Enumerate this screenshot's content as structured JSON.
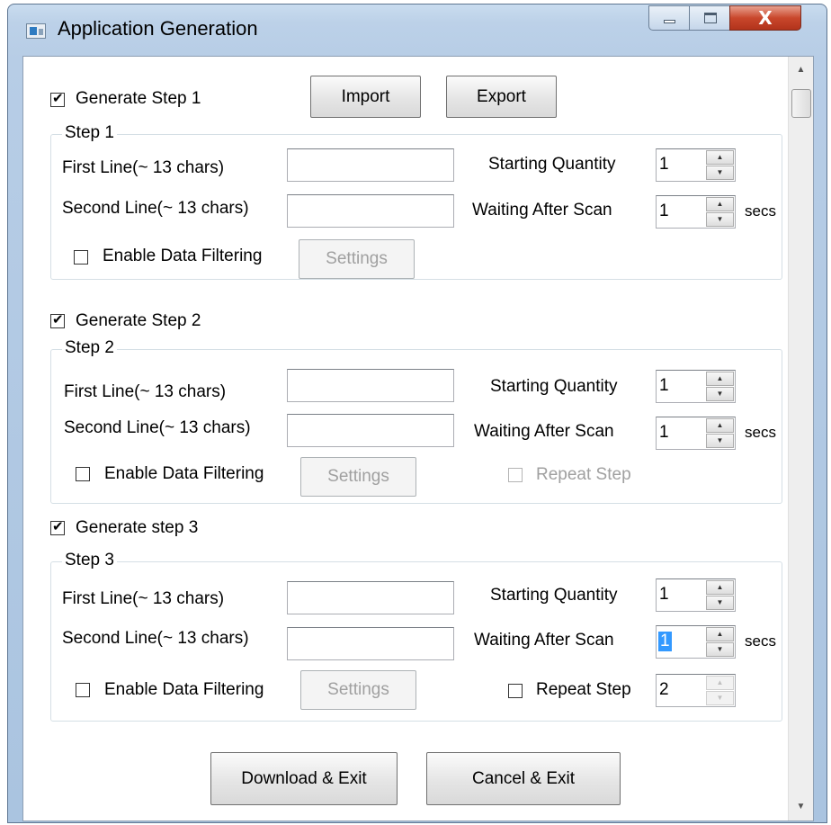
{
  "window": {
    "title": "Application Generation",
    "controls": {
      "close": "X"
    }
  },
  "top": {
    "generate_step1": {
      "label": "Generate Step 1",
      "checked": true
    },
    "import_label": "Import",
    "export_label": "Export"
  },
  "steps": [
    {
      "legend": "Step 1",
      "first_line_label": "First Line(~ 13 chars)",
      "first_line_value": "",
      "second_line_label": "Second Line(~ 13 chars)",
      "second_line_value": "",
      "starting_quantity_label": "Starting Quantity",
      "starting_quantity": "1",
      "waiting_label": "Waiting After Scan",
      "waiting_value": "1",
      "secs": "secs",
      "filtering_label": "Enable Data Filtering",
      "filtering_checked": false,
      "settings_label": "Settings"
    },
    {
      "generate_label": "Generate Step 2",
      "generate_checked": true,
      "legend": "Step 2",
      "first_line_label": "First Line(~ 13 chars)",
      "first_line_value": "",
      "second_line_label": "Second Line(~ 13 chars)",
      "second_line_value": "",
      "starting_quantity_label": "Starting Quantity",
      "starting_quantity": "1",
      "waiting_label": "Waiting After Scan",
      "waiting_value": "1",
      "secs": "secs",
      "filtering_label": "Enable Data Filtering",
      "filtering_checked": false,
      "settings_label": "Settings",
      "repeat_label": "Repeat Step",
      "repeat_enabled": false
    },
    {
      "generate_label": "Generate step 3",
      "generate_checked": true,
      "legend": "Step 3",
      "first_line_label": "First Line(~ 13 chars)",
      "first_line_value": "",
      "second_line_label": "Second Line(~ 13 chars)",
      "second_line_value": "",
      "starting_quantity_label": "Starting Quantity",
      "starting_quantity": "1",
      "waiting_label": "Waiting After Scan",
      "waiting_value": "1",
      "secs": "secs",
      "filtering_label": "Enable Data Filtering",
      "filtering_checked": false,
      "settings_label": "Settings",
      "repeat_label": "Repeat Step",
      "repeat_checked": false,
      "repeat_count": "2"
    }
  ],
  "footer": {
    "download_label": "Download & Exit",
    "cancel_label": "Cancel & Exit"
  }
}
